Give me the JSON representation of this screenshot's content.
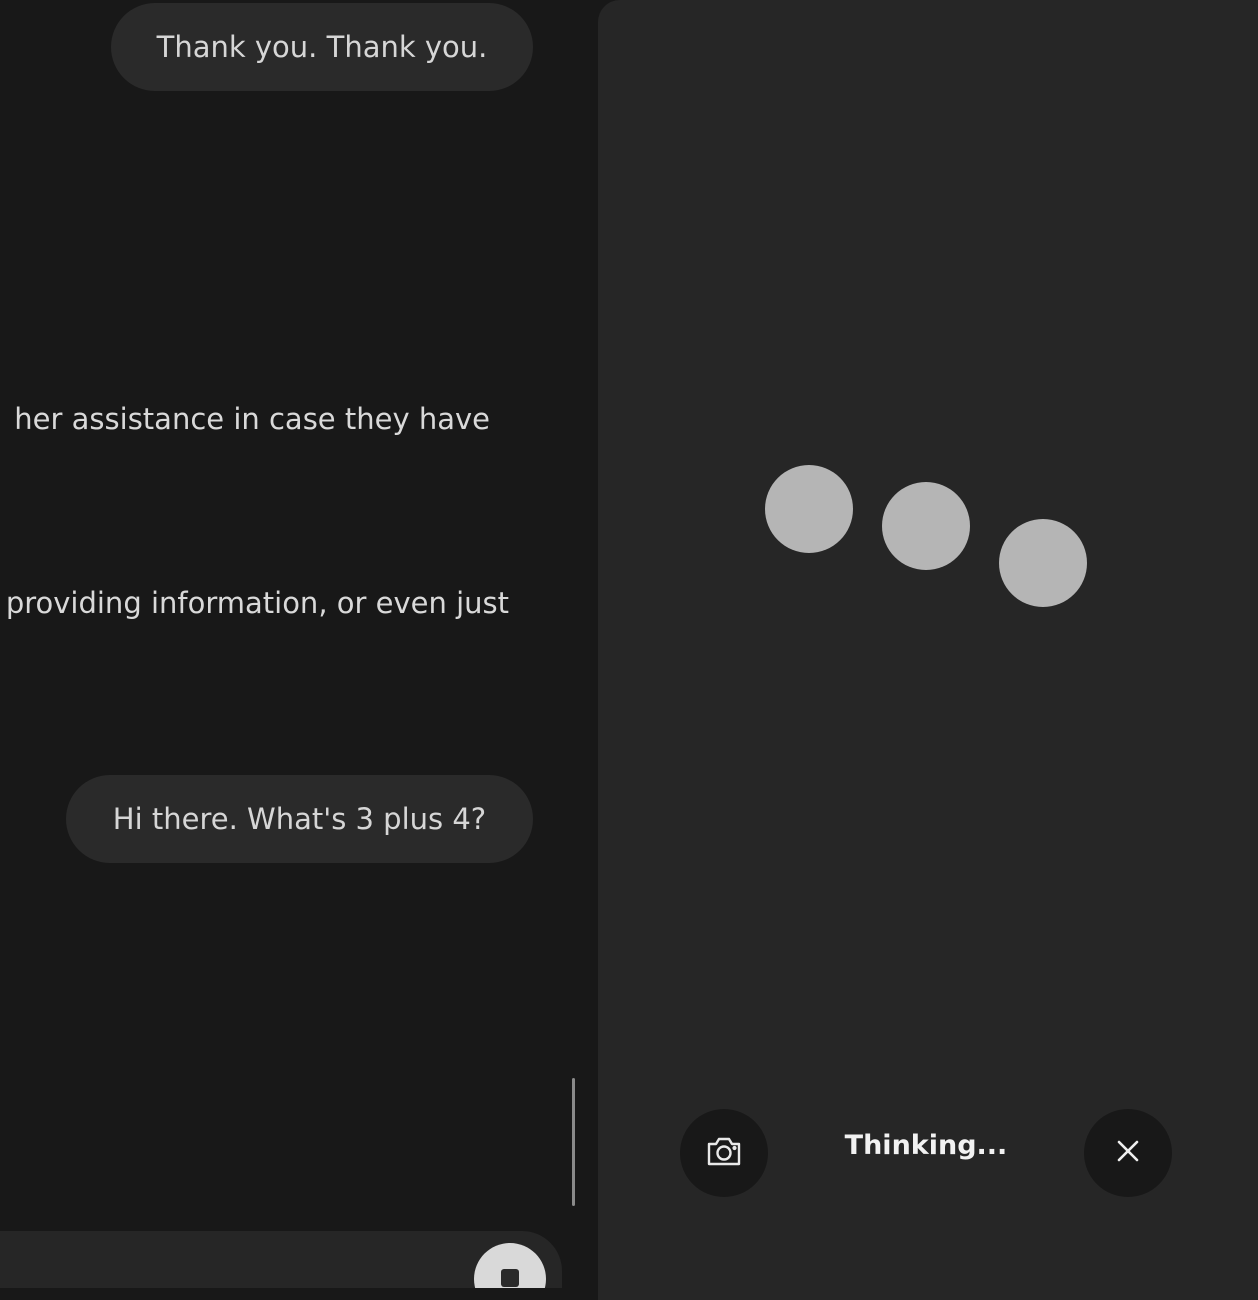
{
  "conversation": {
    "user_message_1": "Thank you. Thank you.",
    "assistant_fragment_1": "her assistance in case they have",
    "assistant_fragment_2": "providing information, or even just",
    "user_message_2": "Hi there. What's 3 plus 4?"
  },
  "composer": {
    "stop_icon": "stop-icon"
  },
  "voice_panel": {
    "status": "Thinking...",
    "indicator": "three-dot-thinking",
    "camera_icon": "camera-icon",
    "close_icon": "close-icon"
  },
  "colors": {
    "background": "#181818",
    "panel": "#262626",
    "bubble": "#2a2a2a",
    "dots": "#b5b5b5"
  }
}
